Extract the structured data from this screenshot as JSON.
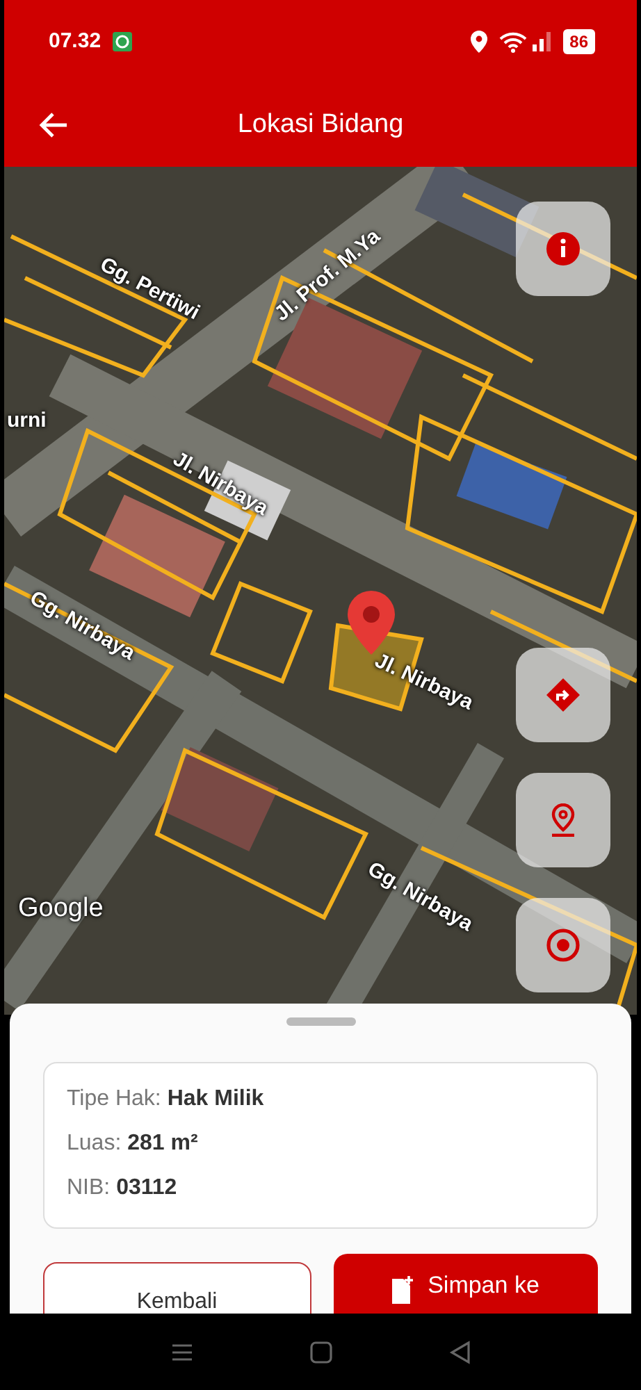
{
  "status_bar": {
    "time": "07.32",
    "battery": "86"
  },
  "app_bar": {
    "title": "Lokasi Bidang"
  },
  "map": {
    "labels": [
      {
        "text": "Gg. Pertiwi"
      },
      {
        "text": "Jl. Prof. M.Ya"
      },
      {
        "text": "urni"
      },
      {
        "text": "Jl. Nirbaya"
      },
      {
        "text": "Gg. Nirbaya"
      },
      {
        "text": "Jl. Nirbaya"
      },
      {
        "text": "Gg. Nirbaya"
      }
    ],
    "attribution": "Google"
  },
  "details": [
    {
      "label": "Tipe Hak:",
      "value": "Hak Milik"
    },
    {
      "label": "Luas:",
      "value": "281 m²"
    },
    {
      "label": "NIB:",
      "value": "03112"
    }
  ],
  "buttons": [
    {
      "label": "Kembali",
      "kind": "outline"
    },
    {
      "label": "Simpan ke",
      "kind": "primary"
    }
  ]
}
